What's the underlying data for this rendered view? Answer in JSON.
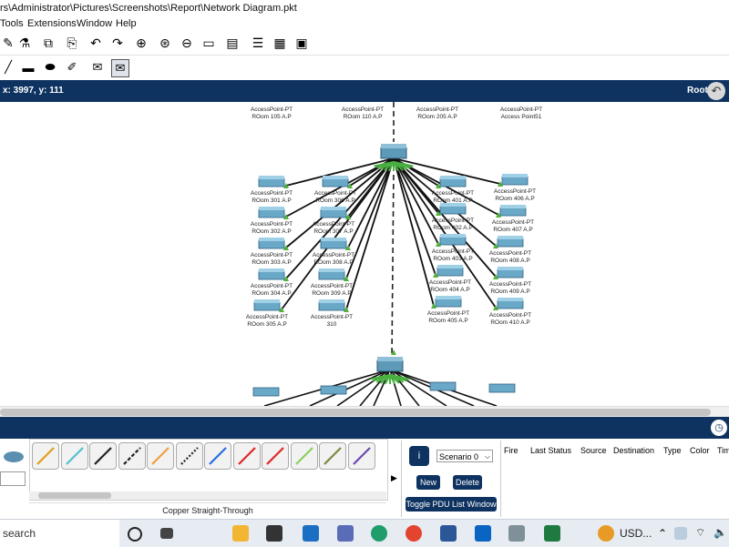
{
  "title_bar": {
    "path": "rs\\Administrator\\Pictures\\Screenshots\\Report\\Network Diagram.pkt"
  },
  "menu": {
    "items": [
      "Tools",
      "Extensions",
      "Window",
      "Help"
    ]
  },
  "toolbar": {
    "icons": [
      "pencil-icon",
      "magic-icon",
      "copy-icon",
      "paste-icon",
      "undo-icon",
      "redo-icon",
      "zoom-in-icon",
      "zoom-reset-icon",
      "zoom-out-icon",
      "rectangle-icon",
      "note-icon",
      "list-icon",
      "server-icon",
      "image-icon"
    ]
  },
  "drawbar": {
    "icons": [
      "line-icon",
      "rect-icon",
      "ellipse-icon",
      "freeform-icon",
      "envelope-icon",
      "open-envelope-icon"
    ]
  },
  "nav": {
    "coords": "x: 3997, y: 111",
    "root_label": "Root"
  },
  "devices": [
    {
      "id": "ap105",
      "l1": "AccessPoint-PT",
      "l2": "ROom 105 A.P"
    },
    {
      "id": "ap110",
      "l1": "AccessPoint-PT",
      "l2": "ROom 110 A.P"
    },
    {
      "id": "ap205",
      "l1": "AccessPoint-PT",
      "l2": "ROom 205 A.P"
    },
    {
      "id": "ap51",
      "l1": "AccessPoint-PT",
      "l2": "Access Point51"
    },
    {
      "id": "ap301",
      "l1": "AccessPoint-PT",
      "l2": "ROom 301 A.P"
    },
    {
      "id": "ap302",
      "l1": "AccessPoint-PT",
      "l2": "ROom 302 A.P"
    },
    {
      "id": "ap303",
      "l1": "AccessPoint-PT",
      "l2": "ROom 303 A.P"
    },
    {
      "id": "ap304",
      "l1": "AccessPoint-PT",
      "l2": "ROom 304 A.P"
    },
    {
      "id": "ap305",
      "l1": "AccessPoint-PT",
      "l2": "ROom 305 A.P"
    },
    {
      "id": "ap306",
      "l1": "AccessPoint-PT",
      "l2": "ROom 306 A.P"
    },
    {
      "id": "ap307",
      "l1": "AccessPoint-PT",
      "l2": "ROom 307 A.P"
    },
    {
      "id": "ap308",
      "l1": "AccessPoint-PT",
      "l2": "ROom 308 A.P"
    },
    {
      "id": "ap309",
      "l1": "AccessPoint-PT",
      "l2": "ROom 309 A.P"
    },
    {
      "id": "ap310",
      "l1": "AccessPoint-PT",
      "l2": "310"
    },
    {
      "id": "ap401",
      "l1": "AccessPoint-PT",
      "l2": "ROom 401 A.P"
    },
    {
      "id": "ap402",
      "l1": "AccessPoint-PT",
      "l2": "ROom 402 A.P"
    },
    {
      "id": "ap403",
      "l1": "AccessPoint-PT",
      "l2": "ROom 403 A.P"
    },
    {
      "id": "ap404",
      "l1": "AccessPoint-PT",
      "l2": "ROom 404 A.P"
    },
    {
      "id": "ap405",
      "l1": "AccessPoint-PT",
      "l2": "ROom 405 A.P"
    },
    {
      "id": "ap406",
      "l1": "AccessPoint-PT",
      "l2": "ROom 406 A.P"
    },
    {
      "id": "ap407",
      "l1": "AccessPoint-PT",
      "l2": "ROom 407 A.P"
    },
    {
      "id": "ap408",
      "l1": "AccessPoint-PT",
      "l2": "ROom 408 A.P"
    },
    {
      "id": "ap409",
      "l1": "AccessPoint-PT",
      "l2": "ROom 409 A.P"
    },
    {
      "id": "ap410",
      "l1": "AccessPoint-PT",
      "l2": "ROom 410 A.P"
    }
  ],
  "cables": {
    "selected_label": "Copper Straight-Through",
    "types": [
      "automatic-cable-icon",
      "console-cable-icon",
      "straight-through-icon",
      "crossover-icon",
      "fiber-icon",
      "phone-cable-icon",
      "coaxial-icon",
      "serial-dce-icon",
      "serial-dte-icon",
      "octal-icon",
      "iot-cable-icon",
      "usb-cable-icon"
    ]
  },
  "scenario": {
    "select": "Scenario 0",
    "new": "New",
    "delete": "Delete",
    "toggle": "Toggle PDU List Window"
  },
  "pdu": {
    "columns": [
      "Fire",
      "Last Status",
      "Source",
      "Destination",
      "Type",
      "Color",
      "Time"
    ]
  },
  "taskbar": {
    "search": "search",
    "currency": "USD..."
  }
}
